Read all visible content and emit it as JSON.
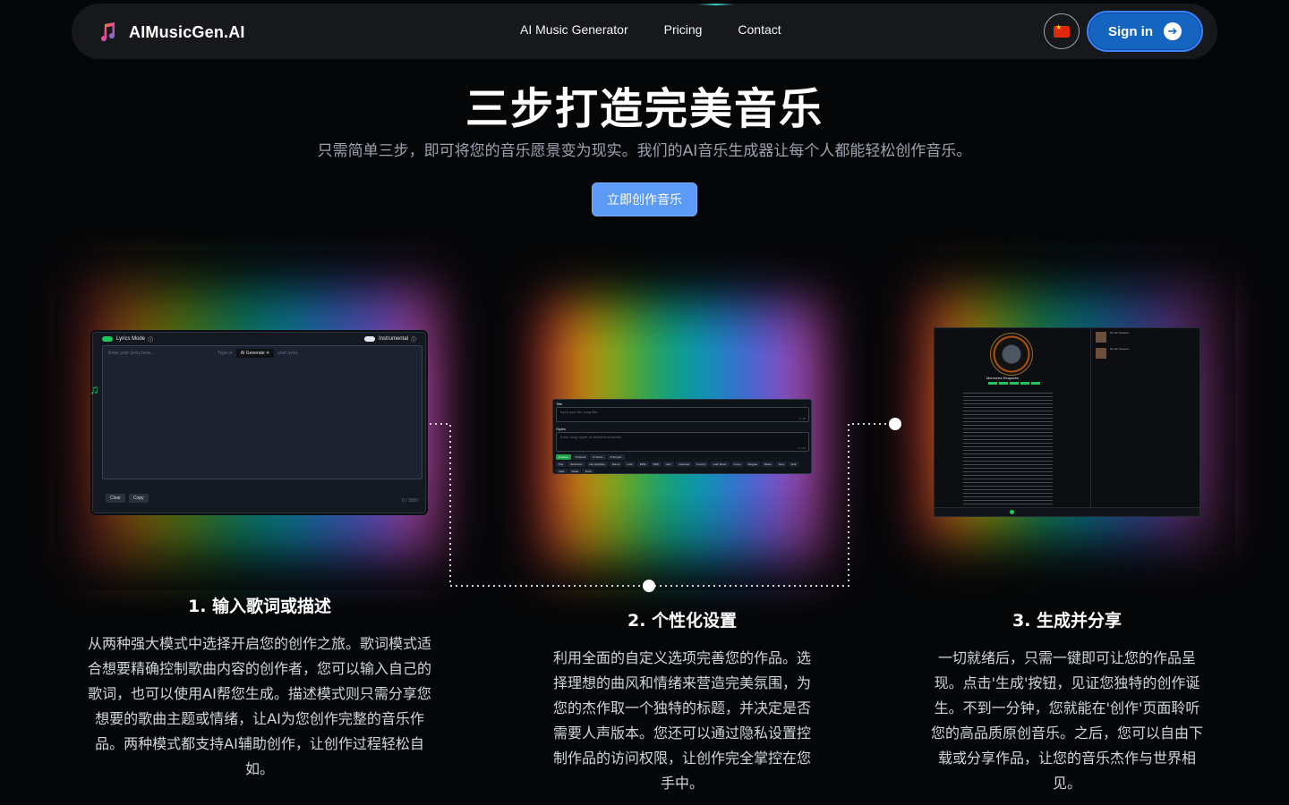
{
  "nav": {
    "brand": "AIMusicGen.AI",
    "links": [
      "AI Music Generator",
      "Pricing",
      "Contact"
    ],
    "signin_label": "Sign in",
    "language_flag": "flag-cn-icon",
    "accent": "#1565c0"
  },
  "hero": {
    "title": "三步打造完美音乐",
    "subtitle": "只需简单三步，即可将您的音乐愿景变为现实。我们的AI音乐生成器让每个人都能轻松创作音乐。",
    "cta_label": "立即创作音乐"
  },
  "steps": [
    {
      "title": "1. 输入歌词或描述",
      "description": "从两种强大模式中选择开启您的创作之旅。歌词模式适合想要精确控制歌曲内容的创作者，您可以输入自己的歌词，也可以使用AI帮您生成。描述模式则只需分享您想要的歌曲主题或情绪，让AI为您创作完整的音乐作品。两种模式都支持AI辅助创作，让创作过程轻松自如。",
      "screenshot": {
        "lyrics_mode_label": "Lyrics Mode",
        "instrumental_label": "Instrumental",
        "lyrics_placeholder": "Enter your lyrics here...",
        "type_or": "Type or",
        "ai_generate": "AI Generate",
        "your_lyrics": "your lyrics",
        "clear": "Clear",
        "copy": "Copy",
        "count": "0 / 3000"
      }
    },
    {
      "title": "2. 个性化设置",
      "description": "利用全面的自定义选项完善您的作品。选择理想的曲风和情绪来营造完美氛围，为您的杰作取一个独特的标题，并决定是否需要人声版本。您还可以通过隐私设置控制作品的访问权限，让创作完全掌控在您手中。",
      "screenshot": {
        "title_label": "Title",
        "title_placeholder": "Input your the song title",
        "title_count": "0 / 80",
        "styles_label": "Styles",
        "styles_placeholder": "Enter song styles or select from below...",
        "styles_count": "0 / 120",
        "style_tabs": [
          "# Genre",
          "# Moods",
          "# Voices",
          "# Tempos"
        ],
        "genres": [
          "Pop",
          "Electronic",
          "Hip Hop/Rap",
          "Dance",
          "Latin",
          "EDM",
          "R&B",
          "Jazz",
          "Classical",
          "Country",
          "Latin Music",
          "K-pop",
          "Reggae",
          "Blues",
          "Soul",
          "Folk",
          "Indie",
          "Metal",
          "Rock"
        ]
      }
    },
    {
      "title": "3. 生成并分享",
      "description": "一切就绪后，只需一键即可让您的作品呈现。点击'生成'按钮，见证您独特的创作诞生。不到一分钟，您就能在'创作'页面聆听您的高品质原创音乐。之后，您可以自由下载或分享作品，让您的音乐杰作与世界相见。",
      "screenshot": {
        "song_title": "Memories Reaparee",
        "list_titles": [
          "Mi Lider Reaparee",
          "Mi Lider Reaparee"
        ]
      }
    }
  ]
}
